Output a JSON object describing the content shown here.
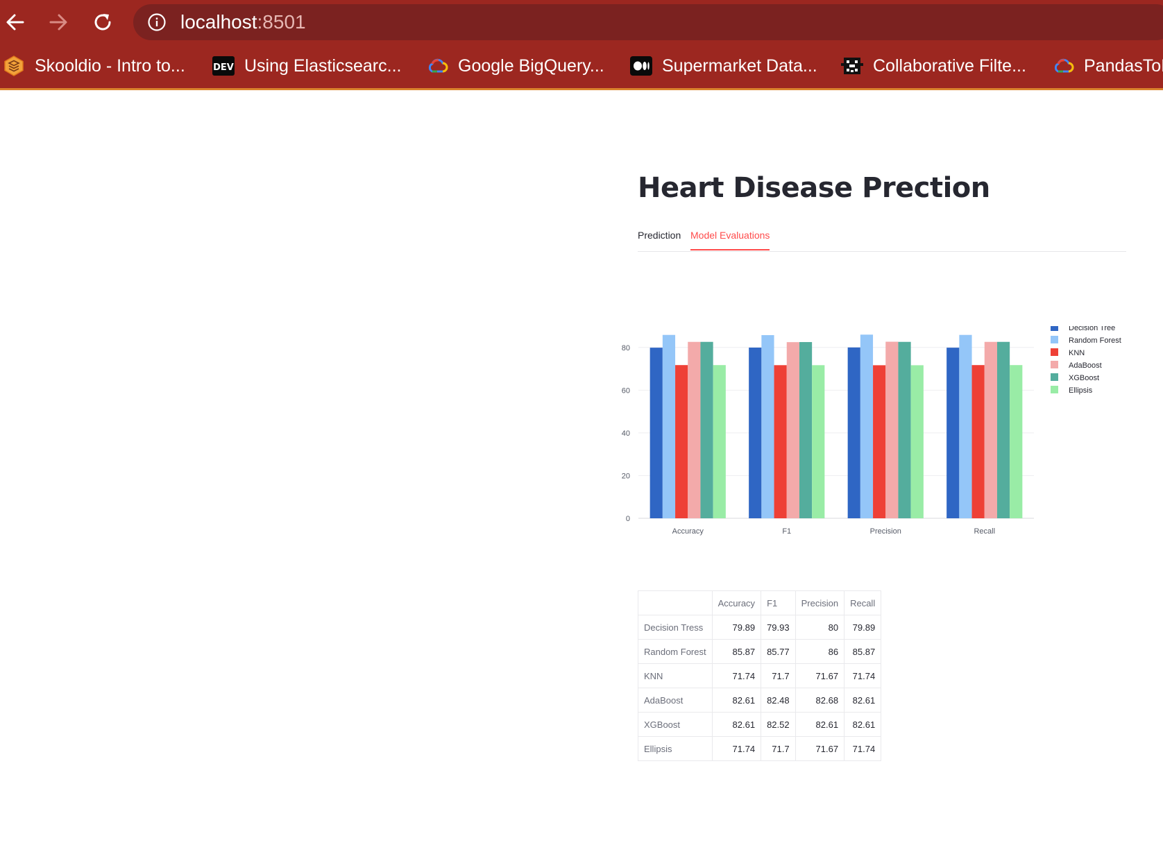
{
  "browser": {
    "url_host": "localhost",
    "url_port": ":8501",
    "bookmarks": [
      {
        "label": "Skooldio - Intro to...",
        "icon": "skooldio-icon"
      },
      {
        "label": "Using Elasticsearc...",
        "icon": "dev-icon"
      },
      {
        "label": "Google BigQuery...",
        "icon": "google-cloud-icon"
      },
      {
        "label": "Supermarket Data...",
        "icon": "medium-icon"
      },
      {
        "label": "Collaborative Filte...",
        "icon": "pixel-bug-icon"
      },
      {
        "label": "PandasToE",
        "icon": "google-cloud-icon"
      }
    ]
  },
  "page": {
    "title": "Heart Disease Prection",
    "tabs": [
      {
        "label": "Prediction",
        "active": false
      },
      {
        "label": "Model Evaluations",
        "active": true
      }
    ]
  },
  "chart_data": {
    "type": "bar",
    "categories": [
      "Accuracy",
      "F1",
      "Precision",
      "Recall"
    ],
    "series": [
      {
        "name": "Decision Tree",
        "color": "#2f66c4",
        "values": [
          79.89,
          79.93,
          80,
          79.89
        ]
      },
      {
        "name": "Random Forest",
        "color": "#94c6f8",
        "values": [
          85.87,
          85.77,
          86,
          85.87
        ]
      },
      {
        "name": "KNN",
        "color": "#ee4036",
        "values": [
          71.74,
          71.7,
          71.67,
          71.74
        ]
      },
      {
        "name": "AdaBoost",
        "color": "#f3aaaa",
        "values": [
          82.61,
          82.48,
          82.68,
          82.61
        ]
      },
      {
        "name": "XGBoost",
        "color": "#54ad9d",
        "values": [
          82.61,
          82.52,
          82.61,
          82.61
        ]
      },
      {
        "name": "Ellipsis",
        "color": "#99eca6",
        "values": [
          71.74,
          71.7,
          71.67,
          71.74
        ]
      }
    ],
    "y_ticks": [
      "0",
      "20",
      "40",
      "60",
      "80"
    ],
    "ylim": [
      0,
      90
    ],
    "grid": true,
    "legend": "right",
    "title": "",
    "xlabel": "",
    "ylabel": ""
  },
  "table": {
    "columns": [
      "",
      "Accuracy",
      "F1",
      "Precision",
      "Recall"
    ],
    "rows": [
      {
        "name": "Decision Tress",
        "values": [
          "79.89",
          "79.93",
          "80",
          "79.89"
        ]
      },
      {
        "name": "Random Forest",
        "values": [
          "85.87",
          "85.77",
          "86",
          "85.87"
        ]
      },
      {
        "name": "KNN",
        "values": [
          "71.74",
          "71.7",
          "71.67",
          "71.74"
        ]
      },
      {
        "name": "AdaBoost",
        "values": [
          "82.61",
          "82.48",
          "82.68",
          "82.61"
        ]
      },
      {
        "name": "XGBoost",
        "values": [
          "82.61",
          "82.52",
          "82.61",
          "82.61"
        ]
      },
      {
        "name": "Ellipsis",
        "values": [
          "71.74",
          "71.7",
          "71.67",
          "71.74"
        ]
      }
    ]
  }
}
